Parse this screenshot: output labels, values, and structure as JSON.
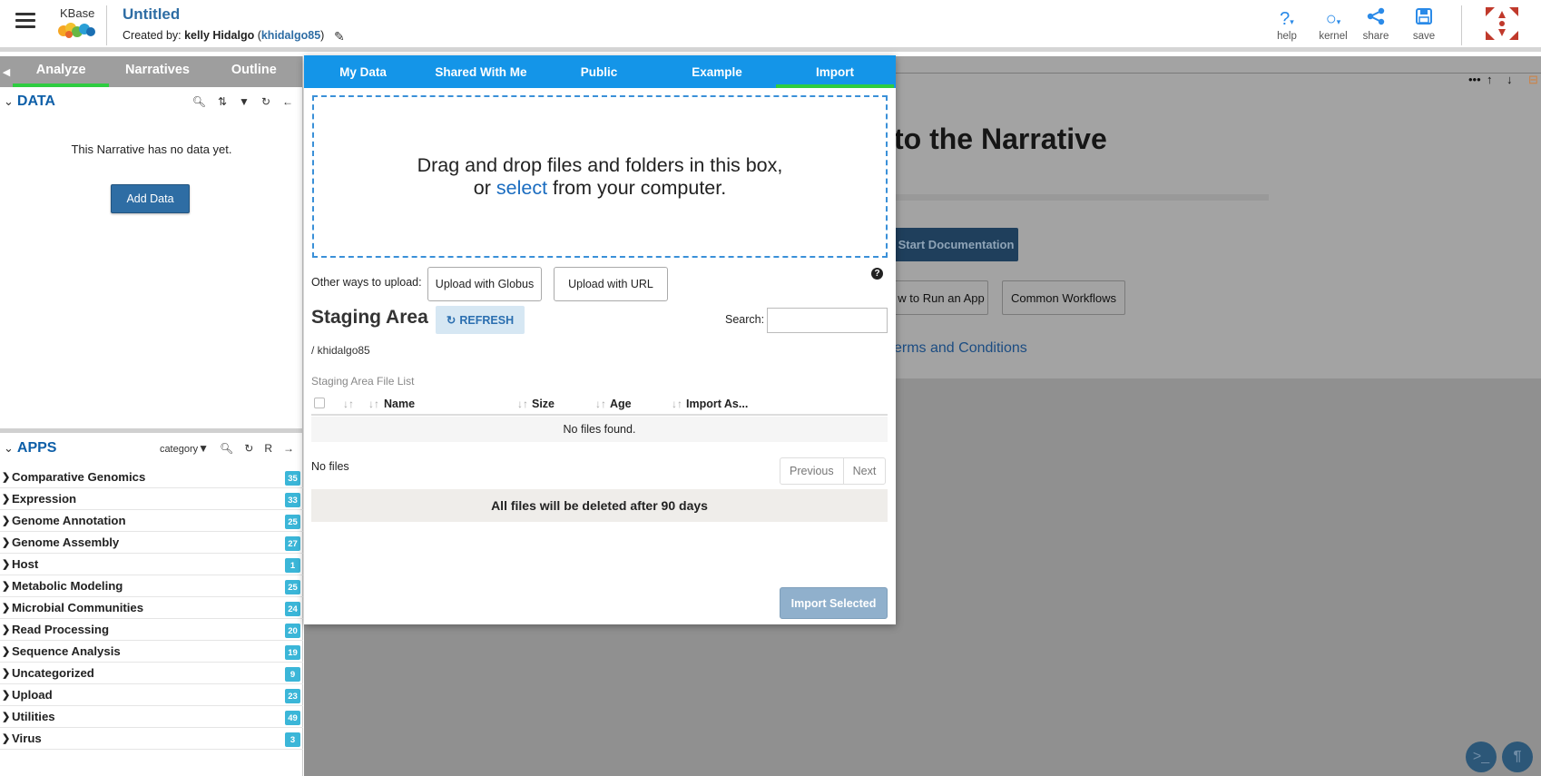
{
  "header": {
    "logo_text": "KBase",
    "title": "Untitled",
    "created_prefix": "Created by:",
    "created_name": "kelly Hidalgo",
    "created_user": "khidalgo85",
    "buttons": {
      "help": "help",
      "kernel": "kernel",
      "share": "share",
      "save": "save"
    }
  },
  "left_tabs": [
    "Analyze",
    "Narratives",
    "Outline"
  ],
  "data_panel": {
    "title": "DATA",
    "empty_text": "This Narrative has no data yet.",
    "add_button": "Add Data"
  },
  "apps_panel": {
    "title": "APPS",
    "filter_label": "category",
    "r_label": "R",
    "categories": [
      {
        "name": "Comparative Genomics",
        "count": "35"
      },
      {
        "name": "Expression",
        "count": "33"
      },
      {
        "name": "Genome Annotation",
        "count": "25"
      },
      {
        "name": "Genome Assembly",
        "count": "27"
      },
      {
        "name": "Host",
        "count": "1"
      },
      {
        "name": "Metabolic Modeling",
        "count": "25"
      },
      {
        "name": "Microbial Communities",
        "count": "24"
      },
      {
        "name": "Read Processing",
        "count": "20"
      },
      {
        "name": "Sequence Analysis",
        "count": "19"
      },
      {
        "name": "Uncategorized",
        "count": "9"
      },
      {
        "name": "Upload",
        "count": "23"
      },
      {
        "name": "Utilities",
        "count": "49"
      },
      {
        "name": "Virus",
        "count": "3"
      }
    ]
  },
  "background": {
    "welcome": "to the Narrative",
    "quick_start": "Start Documentation",
    "run_app": "w to Run an App",
    "workflows": "Common Workflows",
    "terms": "erms and Conditions"
  },
  "modal": {
    "tabs": [
      "My Data",
      "Shared With Me",
      "Public",
      "Example",
      "Import"
    ],
    "drop_line1": "Drag and drop files and folders in this box,",
    "drop_or": "or",
    "drop_select": "select",
    "drop_line2_rest": "from your computer.",
    "other_ways": "Other ways to upload:",
    "globus": "Upload with Globus",
    "url": "Upload with URL",
    "staging_title": "Staging Area",
    "refresh": "REFRESH",
    "search_label": "Search:",
    "path": "/ khidalgo85",
    "file_list_label": "Staging Area File List",
    "columns": [
      "Name",
      "Size",
      "Age",
      "Import As..."
    ],
    "no_files_found": "No files found.",
    "no_files": "No files",
    "previous": "Previous",
    "next": "Next",
    "warning": "All files will be deleted after 90 days",
    "import_selected": "Import Selected"
  },
  "colors": {
    "accent": "#1495e8",
    "active_tab": "#2ecc40",
    "brand_blue": "#2e6da4",
    "badge": "#3bb6d8"
  }
}
